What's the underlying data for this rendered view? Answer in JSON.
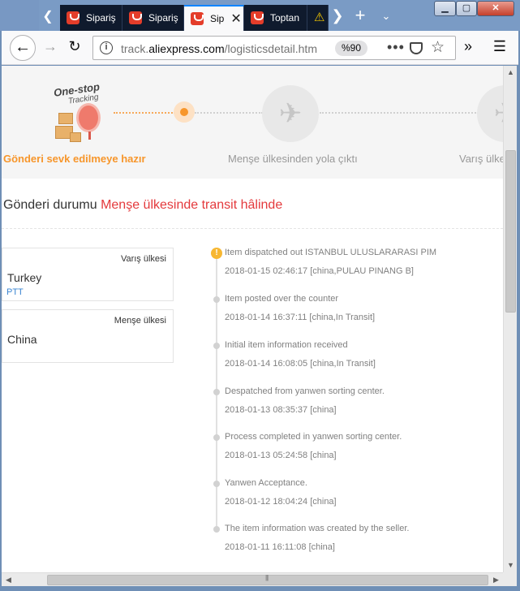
{
  "browser": {
    "tabs": [
      {
        "label": "Sipariş",
        "active": false
      },
      {
        "label": "Sipariş",
        "active": false
      },
      {
        "label": "Sip",
        "active": true
      },
      {
        "label": "Toptan",
        "active": false
      },
      {
        "label": "",
        "active": false
      }
    ],
    "url_prefix": "track.",
    "url_domain": "aliexpress.com",
    "url_path": "/logisticsdetail.htm",
    "zoom": "%90"
  },
  "steps": {
    "logo_line1": "One-stop",
    "logo_line2": "Tracking",
    "items": [
      {
        "label": "Gönderi sevk edilmeye hazır",
        "state": "active"
      },
      {
        "label": "Menşe ülkesinden yola çıktı",
        "state": "pending"
      },
      {
        "label": "Varış ülkesi",
        "state": "pending"
      }
    ]
  },
  "status": {
    "label": "Gönderi durumu",
    "value": "Menşe ülkesinde transit hâlinde"
  },
  "destination": {
    "header": "Varış ülkesi",
    "country": "Turkey",
    "carrier": "PTT"
  },
  "origin": {
    "header": "Menşe ülkesi",
    "country": "China"
  },
  "events": [
    {
      "desc": "Item dispatched out ISTANBUL ULUSLARARASI PIM",
      "time": "2018-01-15 02:46:17 [china,PULAU PINANG B]"
    },
    {
      "desc": "Item posted over the counter",
      "time": "2018-01-14 16:37:11 [china,In Transit]"
    },
    {
      "desc": "Initial item information received",
      "time": "2018-01-14 16:08:05 [china,In Transit]"
    },
    {
      "desc": "Despatched from yanwen sorting center.",
      "time": "2018-01-13 08:35:37 [china]"
    },
    {
      "desc": "Process completed in yanwen sorting center.",
      "time": "2018-01-13 05:24:58 [china]"
    },
    {
      "desc": "Yanwen Acceptance.",
      "time": "2018-01-12 18:04:24 [china]"
    },
    {
      "desc": "The item information was created by the seller.",
      "time": "2018-01-11 16:11:08 [china]"
    }
  ],
  "colors": {
    "accent": "#f7962b",
    "status": "#e4393c",
    "carrier_link": "#3a84d1",
    "tab_active_line": "#0a84ff"
  }
}
